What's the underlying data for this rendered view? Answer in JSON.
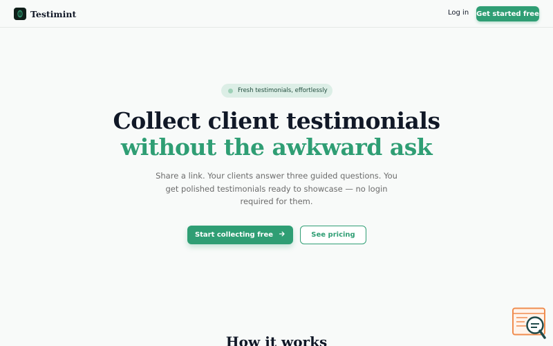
{
  "nav": {
    "brand": "Testimint",
    "login_label": "Log in",
    "cta_label": "Get started free"
  },
  "hero": {
    "badge_text": "Fresh testimonials, effortlessly",
    "title_line1": "Collect client testimonials",
    "title_line2": "without the awkward ask",
    "subtitle": "Share a link. Your clients answer three guided questions. You get polished testimonials ready to showcase — no login required for them.",
    "primary_button": "Start collecting free",
    "secondary_button": "See pricing"
  },
  "sections": {
    "how_title": "How it works"
  },
  "icons": {
    "logo": "leaf-icon",
    "arrow": "arrow-right-icon",
    "chat": "chat-widget-icon"
  },
  "colors": {
    "accent": "#2f9e74",
    "background": "#f8faf9",
    "text": "#111827",
    "muted": "#6b6b6b",
    "badge_bg": "#dceee6"
  }
}
